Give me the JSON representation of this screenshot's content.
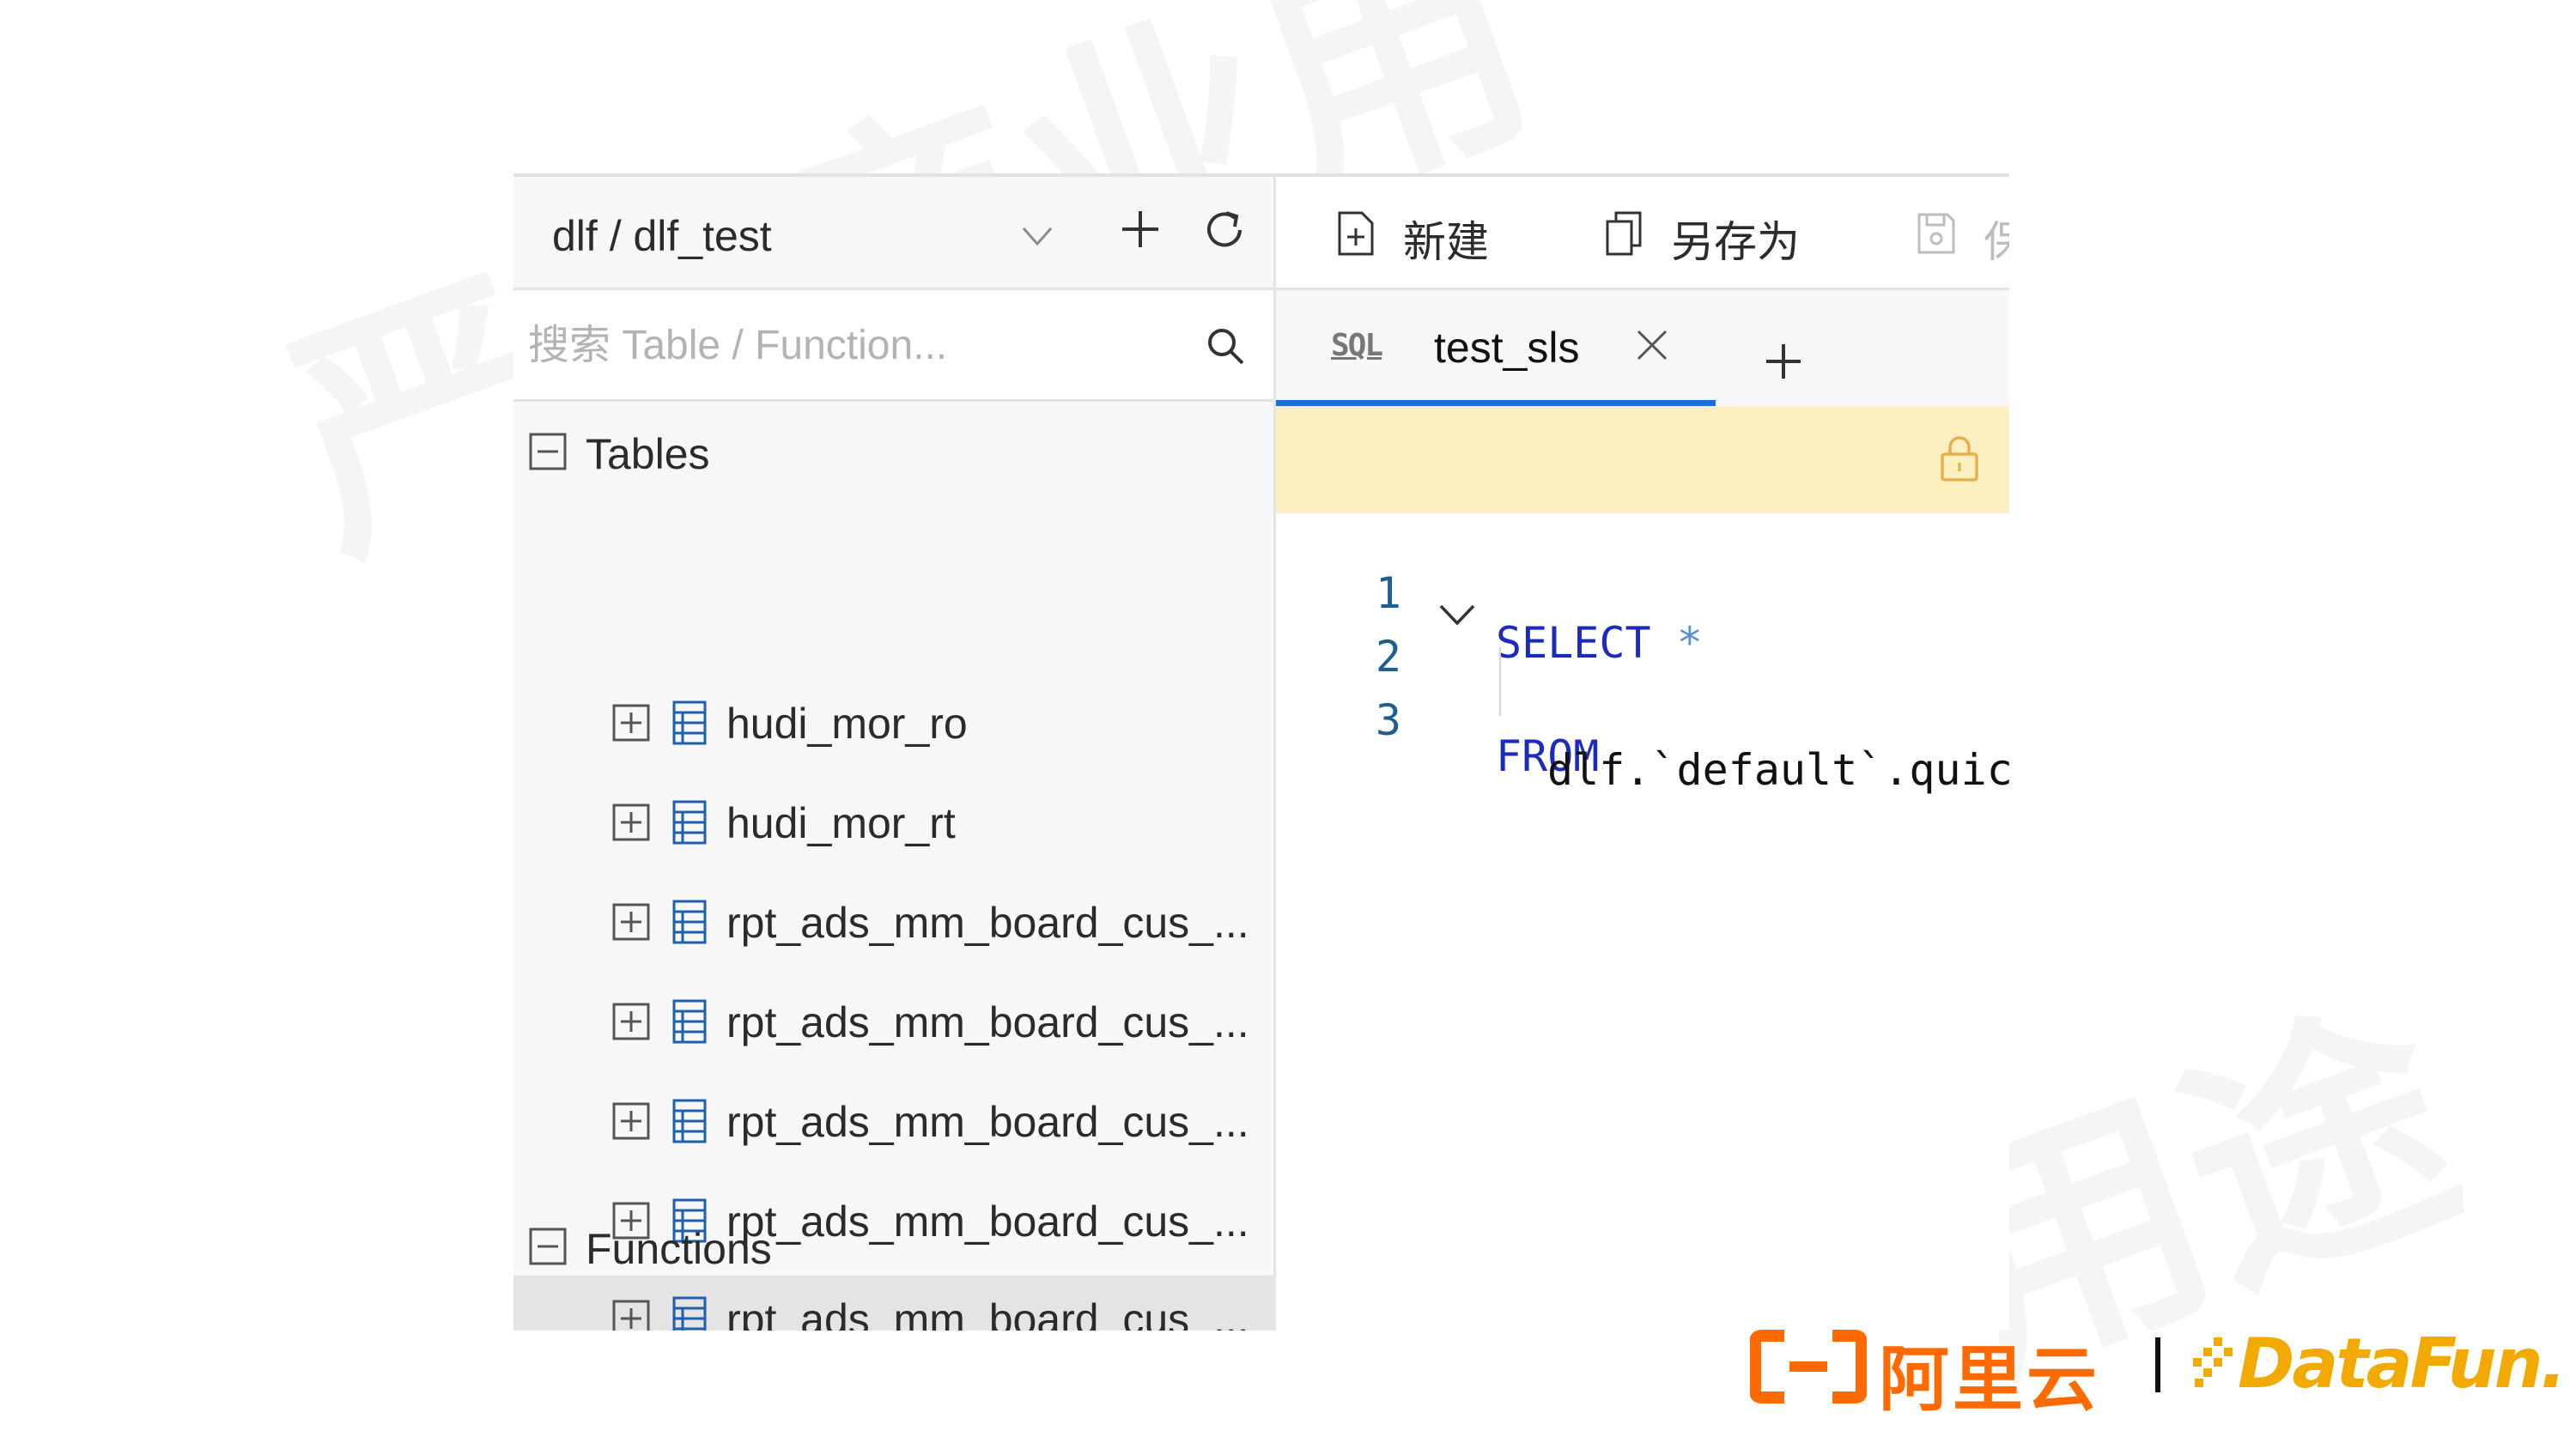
{
  "watermark": {
    "top_text": "严禁商业用",
    "bottom_text": "用途"
  },
  "sidebar": {
    "database_path": "dlf / dlf_test",
    "search_placeholder": "搜索 Table / Function...",
    "tables_label": "Tables",
    "tables": [
      {
        "name": "hudi_mor_ro",
        "selected": false
      },
      {
        "name": "hudi_mor_rt",
        "selected": false
      },
      {
        "name": "rpt_ads_mm_board_cus_...",
        "selected": false
      },
      {
        "name": "rpt_ads_mm_board_cus_...",
        "selected": false
      },
      {
        "name": "rpt_ads_mm_board_cus_...",
        "selected": false
      },
      {
        "name": "rpt_ads_mm_board_cus_...",
        "selected": false
      },
      {
        "name": "rpt_ads_mm_board_cus_...",
        "selected": true
      }
    ],
    "functions_label": "Functions"
  },
  "toolbar": {
    "new_label": "新建",
    "save_as_label": "另存为",
    "save_label": "保"
  },
  "editor": {
    "tab": {
      "icon_text": "SQL",
      "title": "test_sls"
    },
    "lines": [
      {
        "number": "1",
        "keyword": "SELECT",
        "rest": " *"
      },
      {
        "number": "2",
        "keyword": "FROM",
        "rest": ""
      },
      {
        "number": "3",
        "keyword": "",
        "rest": "dlf.`default`.quic"
      }
    ]
  },
  "footer": {
    "brand_name": "阿里云",
    "partner_name": "DataFun."
  },
  "colors": {
    "keyword": "#1a2bbd",
    "tab_active_underline": "#1d6fd8",
    "readonly_banner": "#fcefc0",
    "brand_orange": "#ff6a00",
    "partner_yellow": "#f2a900"
  },
  "icons": [
    "chevron-down-icon",
    "plus-icon",
    "refresh-icon",
    "search-icon",
    "collapse-box-icon",
    "expand-box-icon",
    "table-icon",
    "new-file-icon",
    "copy-icon",
    "save-icon",
    "sql-icon",
    "close-icon",
    "lock-icon",
    "fold-chevron-icon"
  ]
}
